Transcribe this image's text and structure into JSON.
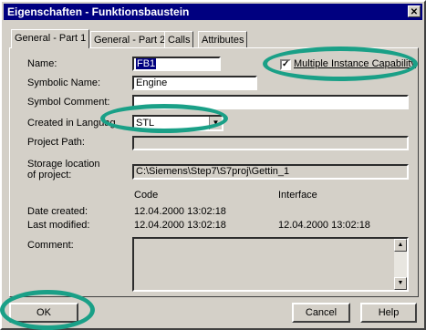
{
  "window": {
    "title": "Eigenschaften - Funktionsbaustein",
    "close": "✕"
  },
  "tabs": [
    "General - Part 1",
    "General - Part 2",
    "Calls",
    "Attributes"
  ],
  "labels": {
    "name": "Name:",
    "symbolic_name": "Symbolic Name:",
    "symbol_comment": "Symbol Comment:",
    "created_in_language": "Created in Languag",
    "project_path": "Project Path:",
    "storage_location_1": "Storage location",
    "storage_location_2": "of project:",
    "code_header": "Code",
    "interface_header": "Interface",
    "date_created": "Date created:",
    "last_modified": "Last modified:",
    "comment": "Comment:"
  },
  "fields": {
    "name": "FB1",
    "symbolic_name": "Engine",
    "symbol_comment": "",
    "language": "STL",
    "project_path": "",
    "storage_location": "C:\\Siemens\\Step7\\S7proj\\Gettin_1",
    "comment": ""
  },
  "multiple_instance": {
    "label": "Multiple Instance Capability",
    "checked": true
  },
  "dates": {
    "code_created": "12.04.2000  13:02:18",
    "code_modified": "12.04.2000  13:02:18",
    "interface_modified": "12.04.2000  13:02:18"
  },
  "buttons": {
    "ok": "OK",
    "cancel": "Cancel",
    "help": "Help"
  },
  "highlight_color": "#1aa087"
}
